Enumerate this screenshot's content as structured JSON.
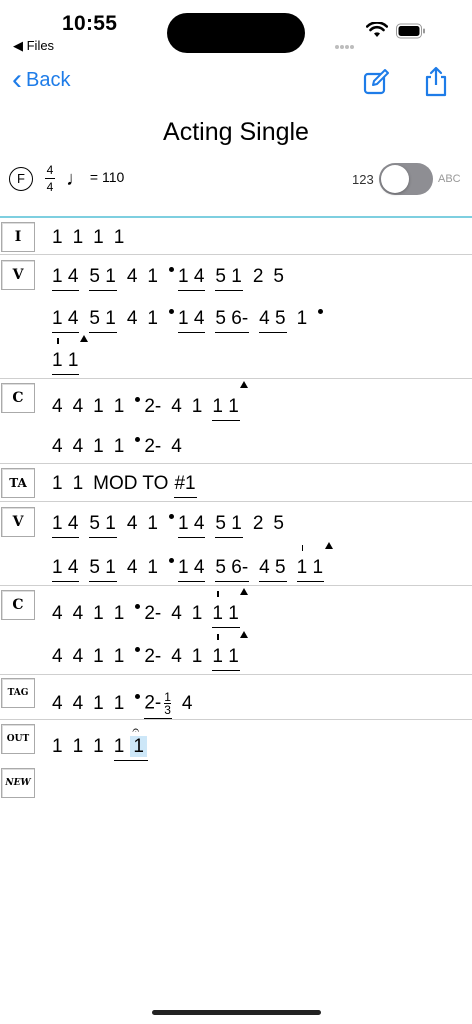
{
  "status": {
    "time": "10:55",
    "back_app": "◀ Files"
  },
  "nav": {
    "back_label": "Back",
    "edit_icon": "compose-icon",
    "share_icon": "share-icon"
  },
  "song": {
    "title": "Acting Single",
    "key": "F",
    "time_num": "4",
    "time_den": "4",
    "tempo": "= 110"
  },
  "toggle": {
    "left_label": "123",
    "right_label": "ABC",
    "state": "off"
  },
  "sections": [
    {
      "label": "I"
    },
    {
      "label": "V"
    },
    {
      "label": "C"
    },
    {
      "label": "TA"
    },
    {
      "label": "V"
    },
    {
      "label": "C"
    },
    {
      "label": "TAG"
    },
    {
      "label": "OUT"
    },
    {
      "label": "NEW"
    }
  ],
  "lines": {
    "intro": [
      "1",
      "1",
      "1",
      "1"
    ],
    "v1a": [
      "1 4",
      "5 1",
      "4",
      "1",
      "1 4",
      "5 1",
      "2",
      "5"
    ],
    "v1b": [
      "1 4",
      "5 1",
      "4",
      "1",
      "1 4",
      "5 6-",
      "4 5",
      "1"
    ],
    "v1c": [
      "1 1"
    ],
    "c1a": [
      "4",
      "4",
      "1",
      "1",
      "2-",
      "4",
      "1",
      "1 1"
    ],
    "c1b": [
      "4",
      "4",
      "1",
      "1",
      "2-",
      "4"
    ],
    "ta": {
      "n1": "1",
      "n2": "1",
      "text": "MOD TO",
      "ref": "#1"
    },
    "v2a": [
      "1 4",
      "5 1",
      "4",
      "1",
      "1 4",
      "5 1",
      "2",
      "5"
    ],
    "v2b": [
      "1 4",
      "5 1",
      "4",
      "1",
      "1 4",
      "5 6-",
      "4 5",
      "1 1"
    ],
    "c2a": [
      "4",
      "4",
      "1",
      "1",
      "2-",
      "4",
      "1",
      "1 1"
    ],
    "c2b": [
      "4",
      "4",
      "1",
      "1",
      "2-",
      "4",
      "1",
      "1 1"
    ],
    "tag": [
      "4",
      "4",
      "1",
      "1",
      "2-",
      "1",
      "3",
      "4"
    ],
    "out": [
      "1",
      "1",
      "1",
      "1",
      "1"
    ]
  }
}
